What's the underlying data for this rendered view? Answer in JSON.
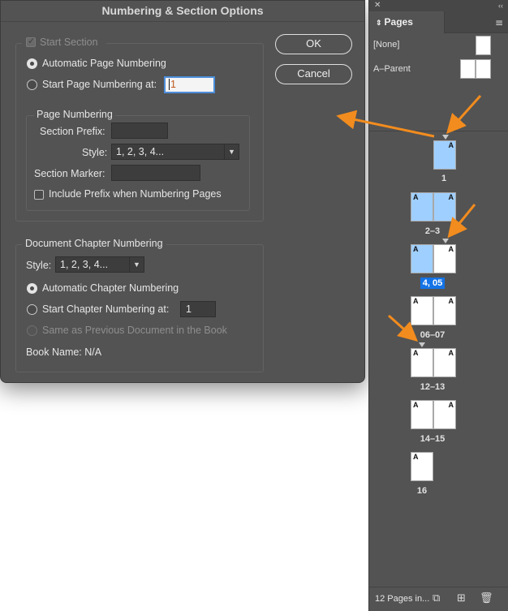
{
  "dialog": {
    "title": "Numbering & Section Options",
    "start_section_label": "Start Section",
    "auto_page_numbering_label": "Automatic Page Numbering",
    "start_page_numbering_label": "Start Page Numbering at:",
    "start_page_numbering_value": "1",
    "page_numbering_group": "Page Numbering",
    "section_prefix_label": "Section Prefix:",
    "section_prefix_value": "",
    "style_label": "Style:",
    "style_value": "1, 2, 3, 4...",
    "section_marker_label": "Section Marker:",
    "section_marker_value": "",
    "include_prefix_label": "Include Prefix when Numbering Pages",
    "chapter_group": "Document Chapter Numbering",
    "chapter_style_label": "Style:",
    "chapter_style_value": "1, 2, 3, 4...",
    "auto_chapter_label": "Automatic Chapter Numbering",
    "start_chapter_label": "Start Chapter Numbering at:",
    "start_chapter_value": "1",
    "same_as_previous_label": "Same as Previous Document in the Book",
    "book_name_label": "Book Name: N/A",
    "ok_label": "OK",
    "cancel_label": "Cancel"
  },
  "panel": {
    "tab_label": "Pages",
    "parents": [
      "[None]",
      "A–Parent"
    ],
    "page_marker": "A",
    "pages": [
      "1",
      "2–3",
      "4, 05",
      "06–07",
      "12–13",
      "14–15",
      "16"
    ],
    "status": "12 Pages in..."
  },
  "colors": {
    "selected_page": "#9fcfff",
    "highlight_label": "#1473e6",
    "annotation_arrow": "#f28c1e"
  }
}
